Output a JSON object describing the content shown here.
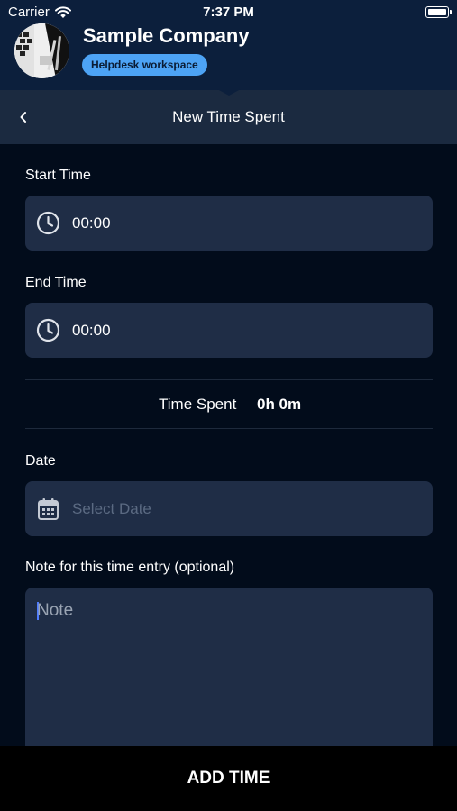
{
  "status_bar": {
    "carrier": "Carrier",
    "time": "7:37 PM",
    "wifi_icon": "wifi-icon",
    "battery_icon": "battery-icon"
  },
  "header": {
    "company_name": "Sample Company",
    "workspace_badge": "Helpdesk workspace",
    "avatar_icon": "company-avatar"
  },
  "nav": {
    "title": "New Time Spent",
    "back_icon": "chevron-left-icon"
  },
  "form": {
    "start_time": {
      "label": "Start Time",
      "value": "00:00",
      "icon": "clock-icon"
    },
    "end_time": {
      "label": "End Time",
      "value": "00:00",
      "icon": "clock-icon"
    },
    "time_spent": {
      "label": "Time Spent",
      "value": "0h 0m"
    },
    "date": {
      "label": "Date",
      "placeholder": "Select Date",
      "icon": "calendar-icon"
    },
    "note": {
      "label": "Note for this time entry (optional)",
      "placeholder": "Note"
    }
  },
  "actions": {
    "add_time": "ADD TIME"
  },
  "colors": {
    "background": "#020c1b",
    "header": "#0c1f3c",
    "navbar": "#1b2a40",
    "field": "#1f2d46",
    "badge": "#4da3f5",
    "placeholder": "#5b6a82"
  }
}
